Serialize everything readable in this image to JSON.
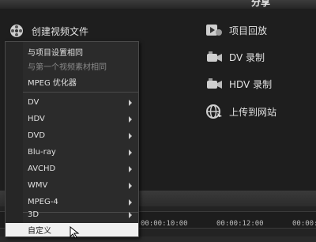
{
  "header": {
    "title": "分享"
  },
  "left_actions": {
    "create_video": "创建视频文件"
  },
  "right_actions": [
    {
      "label": "项目回放",
      "icon": "playback-icon"
    },
    {
      "label": "DV 录制",
      "icon": "camera-icon"
    },
    {
      "label": "HDV 录制",
      "icon": "camera-icon"
    },
    {
      "label": "上传到网站",
      "icon": "globe-icon"
    }
  ],
  "menu": {
    "items": [
      {
        "label": "与项目设置相同",
        "disabled": false,
        "submenu": false
      },
      {
        "label": "与第一个视频素材相同",
        "disabled": true,
        "submenu": false
      },
      {
        "label": "MPEG 优化器",
        "disabled": false,
        "submenu": false
      },
      {
        "label": "DV",
        "disabled": false,
        "submenu": true
      },
      {
        "label": "HDV",
        "disabled": false,
        "submenu": true
      },
      {
        "label": "DVD",
        "disabled": false,
        "submenu": true
      },
      {
        "label": "Blu-ray",
        "disabled": false,
        "submenu": true
      },
      {
        "label": "AVCHD",
        "disabled": false,
        "submenu": true
      },
      {
        "label": "WMV",
        "disabled": false,
        "submenu": true
      },
      {
        "label": "MPEG-4",
        "disabled": false,
        "submenu": true
      },
      {
        "label": "3D",
        "disabled": false,
        "submenu": true
      },
      {
        "label": "自定义",
        "disabled": false,
        "submenu": false,
        "selected": true
      }
    ]
  },
  "timeline": {
    "ticks": [
      "00:00:10:00",
      "00:00:12:00",
      "00:00:14"
    ]
  },
  "colors": {
    "menu_bg": "#2b2b2b",
    "selected_bg": "#f0f0f0",
    "panel_bg": "#1e1e1e"
  }
}
